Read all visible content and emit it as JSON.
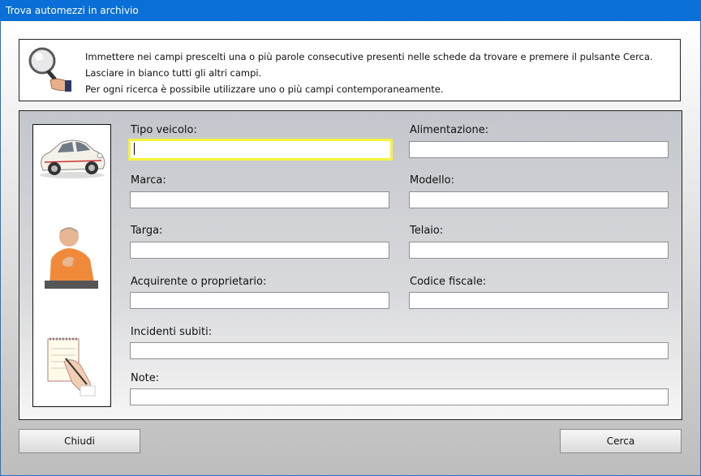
{
  "window": {
    "title": "Trova automezzi in archivio"
  },
  "info": {
    "line1": "Immettere nei campi prescelti una o più parole consecutive presenti nelle schede da trovare e premere il pulsante Cerca.",
    "line2": "Lasciare in bianco tutti gli altri campi.",
    "line3": "Per ogni ricerca è possibile utilizzare uno o più campi contemporaneamente."
  },
  "fields": {
    "tipo_veicolo": {
      "label": "Tipo veicolo:",
      "value": ""
    },
    "alimentazione": {
      "label": "Alimentazione:",
      "value": ""
    },
    "marca": {
      "label": "Marca:",
      "value": ""
    },
    "modello": {
      "label": "Modello:",
      "value": ""
    },
    "targa": {
      "label": "Targa:",
      "value": ""
    },
    "telaio": {
      "label": "Telaio:",
      "value": ""
    },
    "acquirente": {
      "label": "Acquirente o proprietario:",
      "value": ""
    },
    "codice_fiscale": {
      "label": "Codice fiscale:",
      "value": ""
    },
    "incidenti": {
      "label": "Incidenti subiti:",
      "value": ""
    },
    "note": {
      "label": "Note:",
      "value": ""
    }
  },
  "buttons": {
    "close": "Chiudi",
    "search": "Cerca"
  },
  "colors": {
    "titlebar": "#0a6fd6",
    "focus_border": "#f5f33c"
  },
  "icons": [
    "magnifier-hand-icon",
    "car-image",
    "person-image",
    "notepad-writing-image"
  ]
}
